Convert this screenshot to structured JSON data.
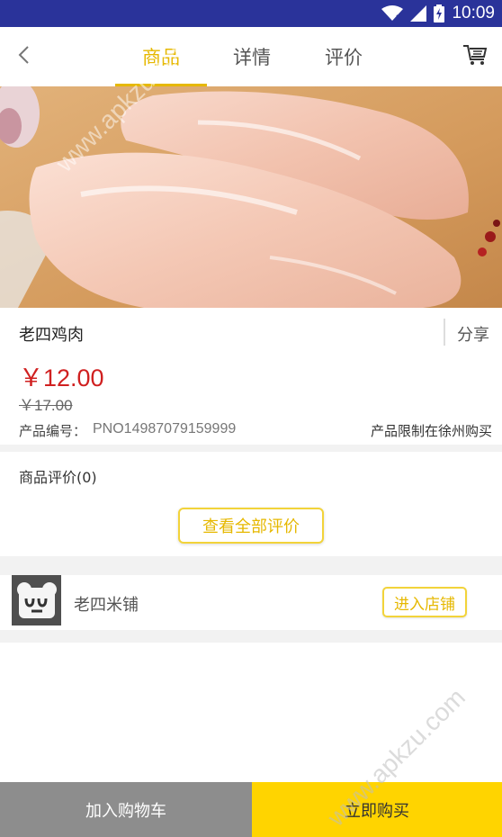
{
  "status_bar": {
    "time": "10:09",
    "icons": [
      "wifi-icon",
      "signal-icon",
      "battery-charging-icon"
    ]
  },
  "nav": {
    "back_icon": "chevron-left-icon",
    "tabs": [
      {
        "label": "商品",
        "active": true
      },
      {
        "label": "详情",
        "active": false
      },
      {
        "label": "评价",
        "active": false
      }
    ],
    "cart_icon": "shopping-cart-icon"
  },
  "product": {
    "name": "老四鸡肉",
    "share_label": "分享",
    "price": "￥12.00",
    "original_price": "￥17.00",
    "code_label": "产品编号：",
    "code_value": "PNO14987079159999",
    "restriction": "产品限制在徐州购买"
  },
  "reviews": {
    "title": "商品评价(0)",
    "view_all_label": "查看全部评价"
  },
  "store": {
    "name": "老四米铺",
    "enter_label": "进入店铺"
  },
  "bottom_bar": {
    "add_to_cart": "加入购物车",
    "buy_now": "立即购买"
  },
  "watermark": "www.apkzu.com",
  "colors": {
    "status_bar": "#2a339a",
    "accent": "#e6b800",
    "price": "#d02020",
    "buy_now_bg": "#ffd400",
    "add_cart_bg": "#8d8d8d"
  }
}
